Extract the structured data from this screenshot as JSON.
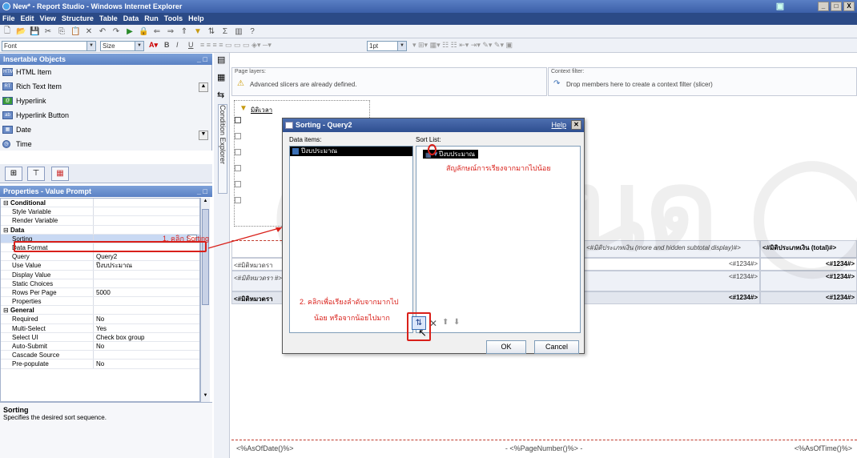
{
  "window": {
    "title": "New* - Report Studio - Windows Internet Explorer",
    "btns": [
      "_",
      "□",
      "X"
    ]
  },
  "menu": [
    "File",
    "Edit",
    "View",
    "Structure",
    "Table",
    "Data",
    "Run",
    "Tools",
    "Help"
  ],
  "format": {
    "font": "Font",
    "size": "Size",
    "pt": "1pt"
  },
  "insertable": {
    "title": "Insertable Objects",
    "items": [
      "HTML Item",
      "Rich Text Item",
      "Hyperlink",
      "Hyperlink Button",
      "Date",
      "Time"
    ]
  },
  "properties": {
    "title": "Properties - Value Prompt",
    "rows": [
      {
        "k": "Conditional",
        "v": "",
        "sec": true
      },
      {
        "k": "Style Variable",
        "v": ""
      },
      {
        "k": "Render Variable",
        "v": ""
      },
      {
        "k": "Data",
        "v": "",
        "sec": true
      },
      {
        "k": "Sorting",
        "v": "",
        "sel": true
      },
      {
        "k": "Data Format",
        "v": ""
      },
      {
        "k": "Query",
        "v": "Query2"
      },
      {
        "k": "Use Value",
        "v": "ปีงบประมาณ"
      },
      {
        "k": "Display Value",
        "v": ""
      },
      {
        "k": "Static Choices",
        "v": ""
      },
      {
        "k": "Rows Per Page",
        "v": "5000"
      },
      {
        "k": "Properties",
        "v": ""
      },
      {
        "k": "General",
        "v": "",
        "sec": true
      },
      {
        "k": "Required",
        "v": "No"
      },
      {
        "k": "Multi-Select",
        "v": "Yes"
      },
      {
        "k": "Select UI",
        "v": "Check box group"
      },
      {
        "k": "Auto-Submit",
        "v": "No"
      },
      {
        "k": "Cascade Source",
        "v": ""
      },
      {
        "k": "Pre-populate",
        "v": "No"
      }
    ],
    "desc_title": "Sorting",
    "desc_text": "Specifies the desired sort sequence."
  },
  "condition_explorer": "Condition Explorer",
  "page_layers": {
    "label": "Page layers:",
    "msg": "Advanced slicers are already defined."
  },
  "context_filter": {
    "label": "Context filter:",
    "msg": "Drop members here to create a context filter (slicer)"
  },
  "slicer": {
    "label": "มิติเวลา"
  },
  "report": {
    "h1": "<#มิติประเภทเงิน (more and hidden subtotal display)#>",
    "h2": "<#มิติประเภทเงิน (total)#>",
    "rows": [
      {
        "a": "<#มิติหมวดรา",
        "b": "<#1234#>",
        "c": "<#1234#>"
      },
      {
        "a": "<#มิติหมวดรา #>",
        "b": "<#1234#>",
        "c": "<#1234#>"
      },
      {
        "a": "<#มิติหมวดรา",
        "b": "<#1234#>",
        "c": "<#1234#>"
      }
    ]
  },
  "footer": {
    "left": "<%AsOfDate()%>",
    "mid": "- <%PageNumber()%> -",
    "right": "<%AsOfTime()%>"
  },
  "dialog": {
    "title": "Sorting - Query2",
    "help": "Help",
    "data_items": "Data items:",
    "sort_list": "Sort List:",
    "item": "ปีงบประมาณ",
    "ok": "OK",
    "cancel": "Cancel"
  },
  "annotations": {
    "step1": "1. คลิก Sorting",
    "step2a": "2. คลิกเพื่อเรียงลำดับจากมากไป",
    "step2b": "น้อย หรือจากน้อยไปมาก",
    "symbol": "สัญลักษณ์การเรียงจากมากไปน้อย"
  }
}
